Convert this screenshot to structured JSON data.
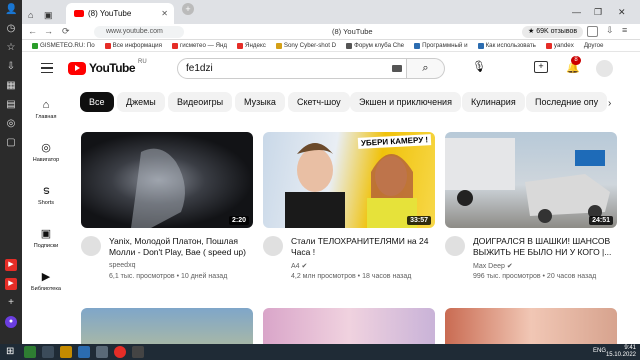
{
  "browser": {
    "tab_title": "(8) YouTube",
    "tab_other": "",
    "url": "www.youtube.com",
    "page_title": "(8) YouTube",
    "reviews": "69K отзывов",
    "bookmarks": [
      "GISMETEO.RU: По",
      "Все информация",
      "гисметео — Янд",
      "Яндекс",
      "Sony Cyber-shot D",
      "Форум клуба Che",
      "Программный и",
      "Как использовать",
      "yandex",
      "Другое"
    ]
  },
  "youtube": {
    "logo": "YouTube",
    "region": "RU",
    "search_value": "fe1dzi",
    "notifications": "8",
    "nav": [
      {
        "label": "Главная",
        "icon": "home-icon"
      },
      {
        "label": "Навигатор",
        "icon": "compass-icon"
      },
      {
        "label": "Shorts",
        "icon": "shorts-icon"
      },
      {
        "label": "Подписки",
        "icon": "subscriptions-icon"
      },
      {
        "label": "Библиотека",
        "icon": "library-icon"
      }
    ],
    "chips": [
      "Все",
      "Джемы",
      "Видеоигры",
      "Музыка",
      "Скетч-шоу",
      "Экшен и приключения",
      "Кулинария",
      "Последние опу"
    ],
    "videos": [
      {
        "title": "Yanix, Молодой Платон, Пошлая Молли - Don't Play, Bae ( speed up)",
        "channel": "speedxq",
        "stats": "6,1 тыс. просмотров • 10 дней назад",
        "duration": "2:20"
      },
      {
        "title": "Стали ТЕЛОХРАНИТЕЛЯМИ на 24 Часа !",
        "channel": "A4",
        "stats": "4,2 млн просмотров • 18 часов назад",
        "duration": "33:57",
        "overlay": "УБЕРИ КАМЕРУ !"
      },
      {
        "title": "ДОИГРАЛСЯ В ШАШКИ! ШАНСОВ ВЫЖИТЬ НЕ БЫЛО НИ У КОГО |...",
        "channel": "Max Deep",
        "stats": "996 тыс. просмотров • 20 часов назад",
        "duration": "24:51"
      }
    ]
  },
  "taskbar": {
    "lang": "ENG",
    "time": "9:41",
    "date": "15.10.2022"
  }
}
